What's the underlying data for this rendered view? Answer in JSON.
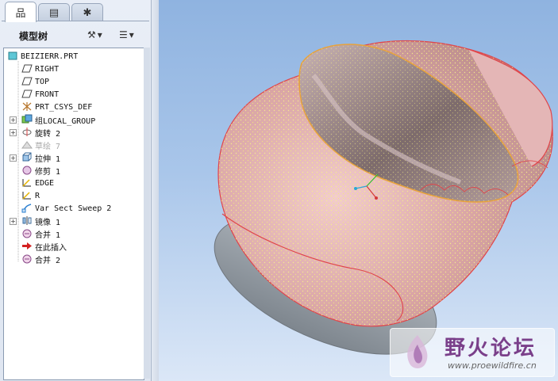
{
  "tabs": [
    {
      "icon": "model-tree-tab-icon",
      "glyph": "品",
      "active": true
    },
    {
      "icon": "folder-browser-tab-icon",
      "glyph": "▤",
      "active": false
    },
    {
      "icon": "favorites-tab-icon",
      "glyph": "✱",
      "active": false
    }
  ],
  "panel": {
    "title": "模型树",
    "settings_glyph": "⚒",
    "show_glyph": "☰",
    "dropdown_glyph": "▾"
  },
  "tree": {
    "items": [
      {
        "label": "BEIZIERR.PRT",
        "icon": "part-icon",
        "expand": false,
        "dim": false
      },
      {
        "label": "RIGHT",
        "icon": "datum-plane-icon",
        "expand": false,
        "dim": false
      },
      {
        "label": "TOP",
        "icon": "datum-plane-icon",
        "expand": false,
        "dim": false
      },
      {
        "label": "FRONT",
        "icon": "datum-plane-icon",
        "expand": false,
        "dim": false
      },
      {
        "label": "PRT_CSYS_DEF",
        "icon": "csys-icon",
        "expand": false,
        "dim": false
      },
      {
        "label": "组LOCAL_GROUP",
        "icon": "group-icon",
        "expand": true,
        "dim": false
      },
      {
        "label": "旋转 2",
        "icon": "revolve-icon",
        "expand": true,
        "dim": false
      },
      {
        "label": "草绘 7",
        "icon": "sketch-icon",
        "expand": false,
        "dim": true
      },
      {
        "label": "拉伸 1",
        "icon": "extrude-icon",
        "expand": true,
        "dim": false
      },
      {
        "label": "修剪 1",
        "icon": "trim-icon",
        "expand": false,
        "dim": false
      },
      {
        "label": "EDGE",
        "icon": "datum-curve-icon",
        "expand": false,
        "dim": false
      },
      {
        "label": "R",
        "icon": "datum-curve-icon",
        "expand": false,
        "dim": false
      },
      {
        "label": "Var Sect Sweep 2",
        "icon": "sweep-icon",
        "expand": false,
        "dim": false
      },
      {
        "label": "镜像 1",
        "icon": "mirror-icon",
        "expand": true,
        "dim": false
      },
      {
        "label": "合并 1",
        "icon": "merge-icon",
        "expand": false,
        "dim": false
      },
      {
        "label": "在此插入",
        "icon": "insert-here-arrow-icon",
        "expand": false,
        "dim": false
      },
      {
        "label": "合并 2",
        "icon": "merge-icon",
        "expand": false,
        "dim": false
      }
    ]
  },
  "watermark": {
    "title": "野火论坛",
    "url": "www.proewildfire.cn"
  },
  "colors": {
    "surface": "#e8b8b8",
    "edge": "#e0454a",
    "mesh": "#f6f08a",
    "highlight": "#e8a23a",
    "base": "#9ea6ae"
  }
}
